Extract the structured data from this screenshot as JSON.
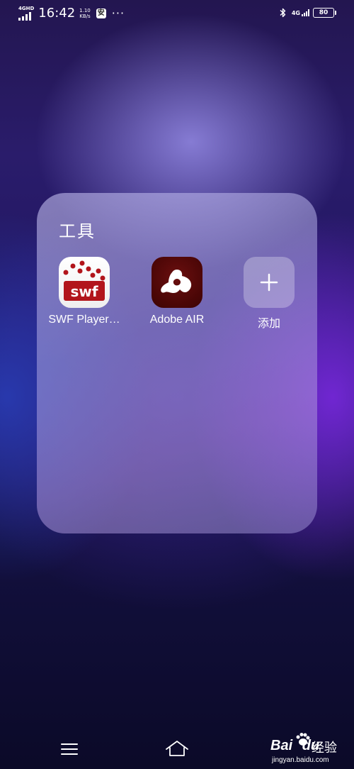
{
  "status_bar": {
    "network_type": "4GHD",
    "time": "16:42",
    "speed_value": "1.10",
    "speed_unit": "KB/s",
    "app_badge": "安",
    "more": "···",
    "right_network": "4G",
    "battery": "80"
  },
  "folder": {
    "title": "工具",
    "apps": [
      {
        "label": "SWF Player…",
        "icon": "swf-player-icon"
      },
      {
        "label": "Adobe AIR",
        "icon": "adobe-air-icon"
      },
      {
        "label": "添加",
        "icon": "plus-icon"
      }
    ]
  },
  "swf_icon_text": "swf",
  "nav": {
    "menu_icon": "menu-icon",
    "home_icon": "home-icon"
  },
  "watermark": {
    "brand": "Bai",
    "brand_suffix": "du",
    "name": "经验",
    "site": "jingyan.baidu.com"
  }
}
